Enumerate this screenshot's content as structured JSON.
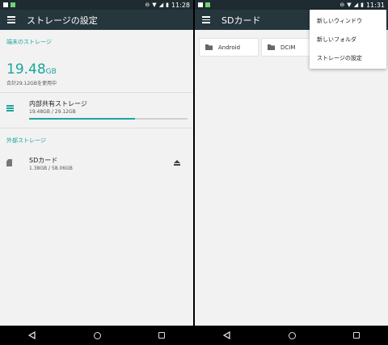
{
  "left": {
    "status": {
      "time": "11:28"
    },
    "appbar": {
      "title": "ストレージの設定"
    },
    "device_section": {
      "label": "端末のストレージ"
    },
    "total": {
      "value": "19.48",
      "unit": "GB",
      "subtitle": "合計29.12GBを使用中"
    },
    "internal": {
      "title": "内部共有ストレージ",
      "usage": "19.48GB / 29.12GB",
      "fraction": 0.669
    },
    "external_section": {
      "label": "外部ストレージ"
    },
    "sdcard": {
      "title": "SDカード",
      "usage": "1.38GB / 58.06GB"
    }
  },
  "right": {
    "status": {
      "time": "11:31"
    },
    "appbar": {
      "title": "SDカード"
    },
    "folders": [
      "Android",
      "DCIM"
    ],
    "menu": [
      "新しいウィンドウ",
      "新しいフォルダ",
      "ストレージの設定"
    ]
  },
  "colors": {
    "accent": "#1aa79c",
    "appbar": "#26363d",
    "statusbar": "#1e2b31"
  },
  "icons": [
    "menu-icon",
    "list-icon",
    "sd-card-icon",
    "eject-icon",
    "folder-icon",
    "back-icon",
    "home-icon",
    "recents-icon"
  ]
}
